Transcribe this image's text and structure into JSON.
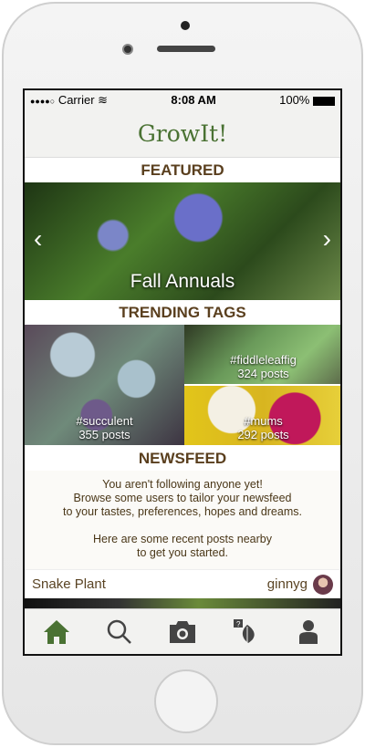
{
  "status": {
    "signal": "●●●●○",
    "carrier": "Carrier",
    "time": "8:08 AM",
    "battery": "100%"
  },
  "app": {
    "title": "GrowIt!"
  },
  "featured": {
    "heading": "FEATURED",
    "caption": "Fall Annuals",
    "prev_icon": "chevron-left-icon",
    "next_icon": "chevron-right-icon"
  },
  "trending": {
    "heading": "TRENDING TAGS",
    "tags": [
      {
        "tag": "#succulent",
        "posts": "355 posts"
      },
      {
        "tag": "#fiddleleaffig",
        "posts": "324 posts"
      },
      {
        "tag": "#mums",
        "posts": "292 posts"
      }
    ]
  },
  "newsfeed": {
    "heading": "NEWSFEED",
    "message": [
      "You aren't following anyone yet!",
      "Browse some users to tailor your newsfeed",
      "to your tastes, preferences, hopes and dreams.",
      "",
      "Here are some recent posts nearby",
      "to get you started."
    ],
    "post": {
      "title": "Snake Plant",
      "user": "ginnyg"
    }
  },
  "tabs": [
    {
      "name": "home",
      "active": true
    },
    {
      "name": "search"
    },
    {
      "name": "camera"
    },
    {
      "name": "plant-help"
    },
    {
      "name": "profile"
    }
  ],
  "colors": {
    "accent": "#4a7233",
    "heading": "#5a3f1e",
    "icon": "#444444"
  }
}
